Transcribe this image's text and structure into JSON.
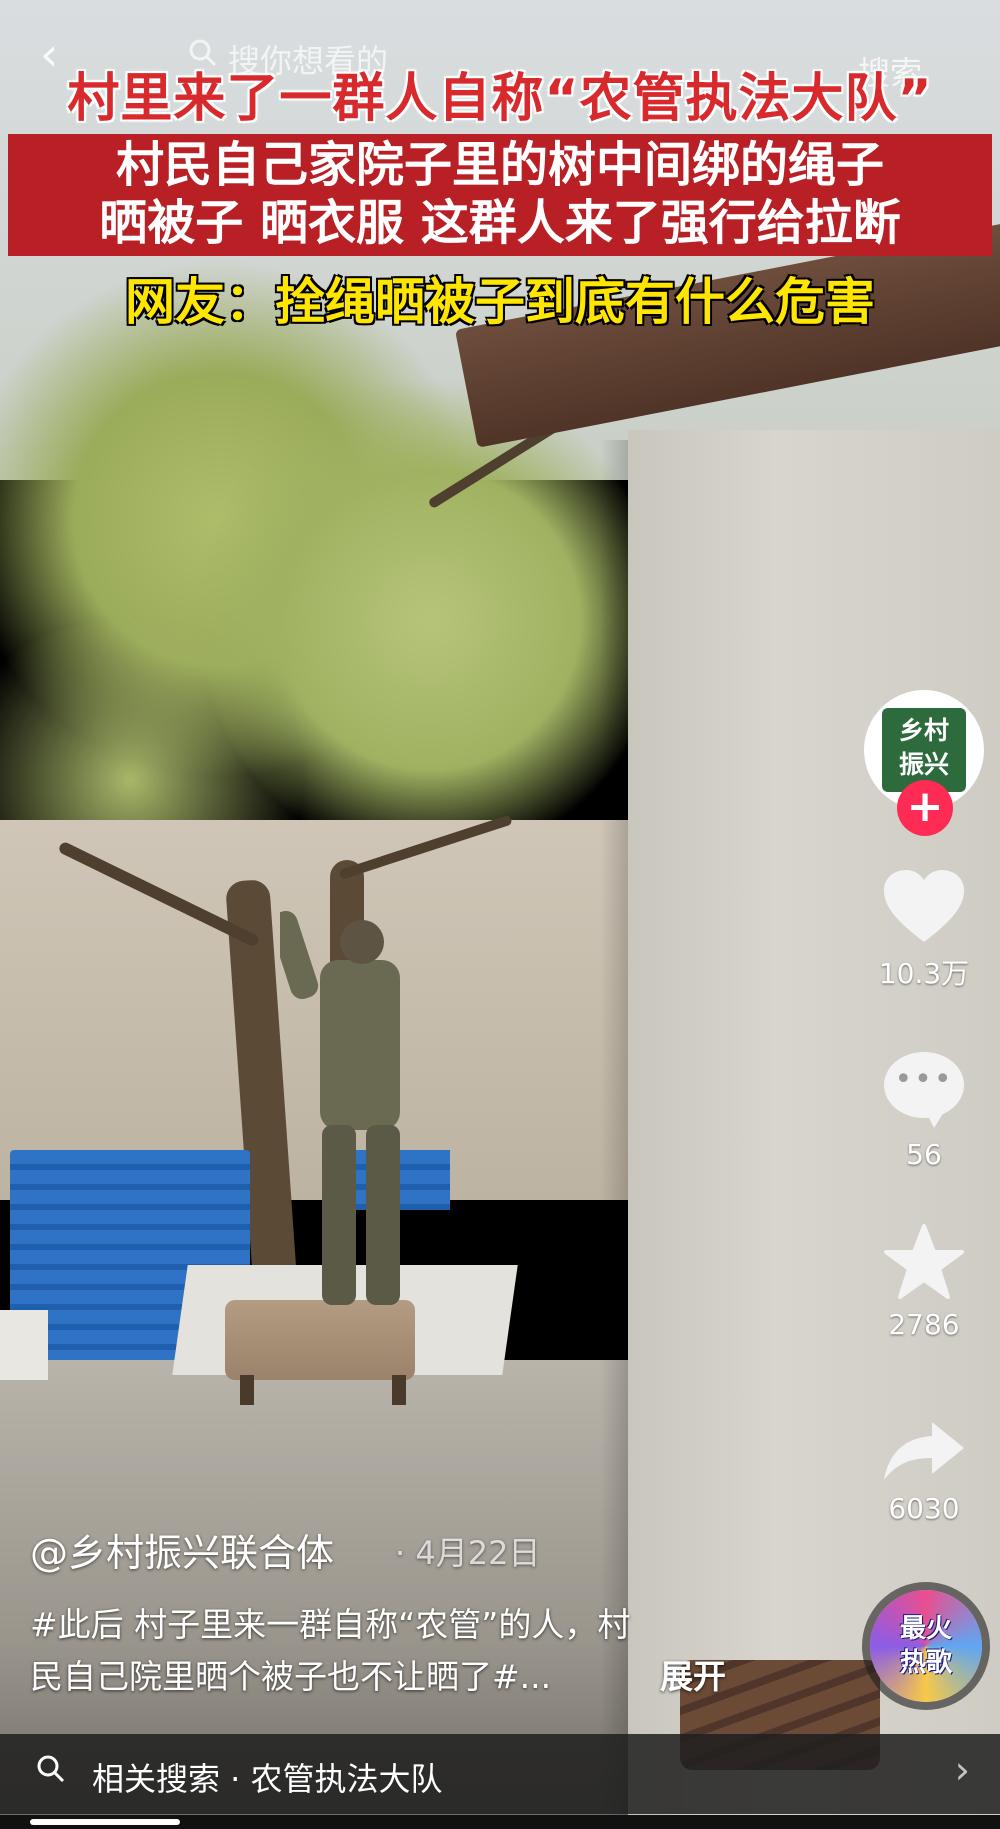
{
  "top_bar": {
    "search_placeholder": "搜你想看的",
    "search_button": "搜索"
  },
  "captions": {
    "line1": "村里来了一群人自称“农管执法大队”",
    "line2": "村民自己家院子里的树中间绑的绳子",
    "line3": "晒被子 晒衣服 这群人来了强行给拉断",
    "line4": "网友：拴绳晒被子到底有什么危害"
  },
  "creator": {
    "avatar_text_top": "乡村",
    "avatar_text_bottom": "振兴"
  },
  "actions": {
    "likes": "10.3万",
    "comments": "56",
    "favorites": "2786",
    "shares": "6030"
  },
  "music": {
    "label_top": "最火",
    "label_bottom": "热歌"
  },
  "post": {
    "author": "@乡村振兴联合体",
    "date": "· 4月22日",
    "description_line1": "#此后 村子里来一群自称“农管”的人，村",
    "description_line2": "民自己院里晒个被子也不让晒了#...",
    "expand": "展开"
  },
  "related": {
    "text": "相关搜索 · 农管执法大队"
  },
  "playback": {
    "progress": 0.16
  },
  "icons": {
    "back": "chevron-left-icon",
    "search": "search-icon",
    "like": "heart-icon",
    "comment": "comment-bubble-icon",
    "favorite": "star-icon",
    "share": "share-arrow-icon",
    "related_arrow": "chevron-right-icon"
  },
  "colors": {
    "caption_red": "#d8292c",
    "caption_box": "#b92025",
    "caption_yellow": "#ffe600",
    "follow_pink": "#fe2c55"
  }
}
